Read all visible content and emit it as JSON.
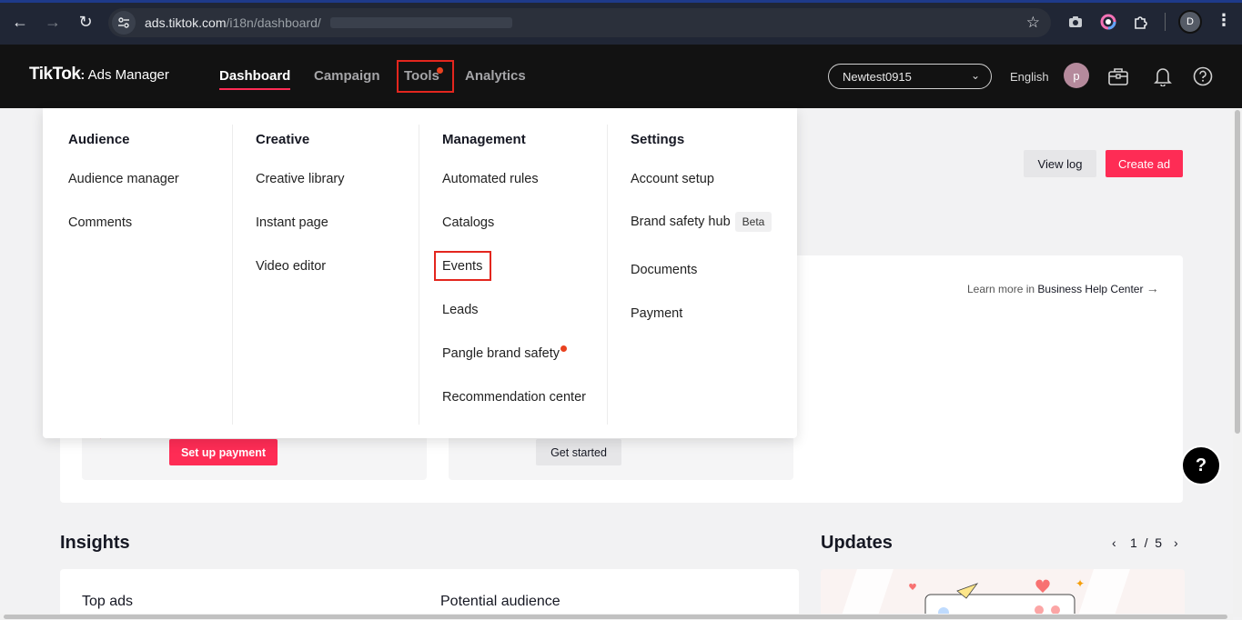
{
  "browser": {
    "url_host": "ads.tiktok.com",
    "url_path": "/i18n/dashboard/",
    "profile_initial": "D"
  },
  "header": {
    "logo": "TikTok",
    "logo_sub": "Ads Manager",
    "nav": {
      "dashboard": "Dashboard",
      "campaign": "Campaign",
      "tools": "Tools",
      "analytics": "Analytics"
    },
    "account": "Newtest0915",
    "language": "English",
    "avatar_initial": "p"
  },
  "main": {
    "view_log": "View log",
    "create_ad": "Create ad",
    "learn_prefix": "Learn more in",
    "learn_link": "Business Help Center",
    "set_up_payment": "Set up payment",
    "get_started": "Get started",
    "insights": "Insights",
    "top_ads": "Top ads",
    "potential_audience": "Potential audience",
    "updates": "Updates",
    "pager_current": "1",
    "pager_sep": "/",
    "pager_total": "5"
  },
  "dropdown": {
    "audience": {
      "title": "Audience",
      "items": [
        "Audience manager",
        "Comments"
      ]
    },
    "creative": {
      "title": "Creative",
      "items": [
        "Creative library",
        "Instant page",
        "Video editor"
      ]
    },
    "management": {
      "title": "Management",
      "items": [
        "Automated rules",
        "Catalogs",
        "Events",
        "Leads",
        "Pangle brand safety",
        "Recommendation center"
      ]
    },
    "settings": {
      "title": "Settings",
      "items": [
        "Account setup",
        "Brand safety hub",
        "Documents",
        "Payment"
      ],
      "beta": "Beta"
    }
  },
  "colors": {
    "brand_pink": "#fe2c55",
    "header_bg": "#121212",
    "highlight_red": "#e3261e"
  }
}
